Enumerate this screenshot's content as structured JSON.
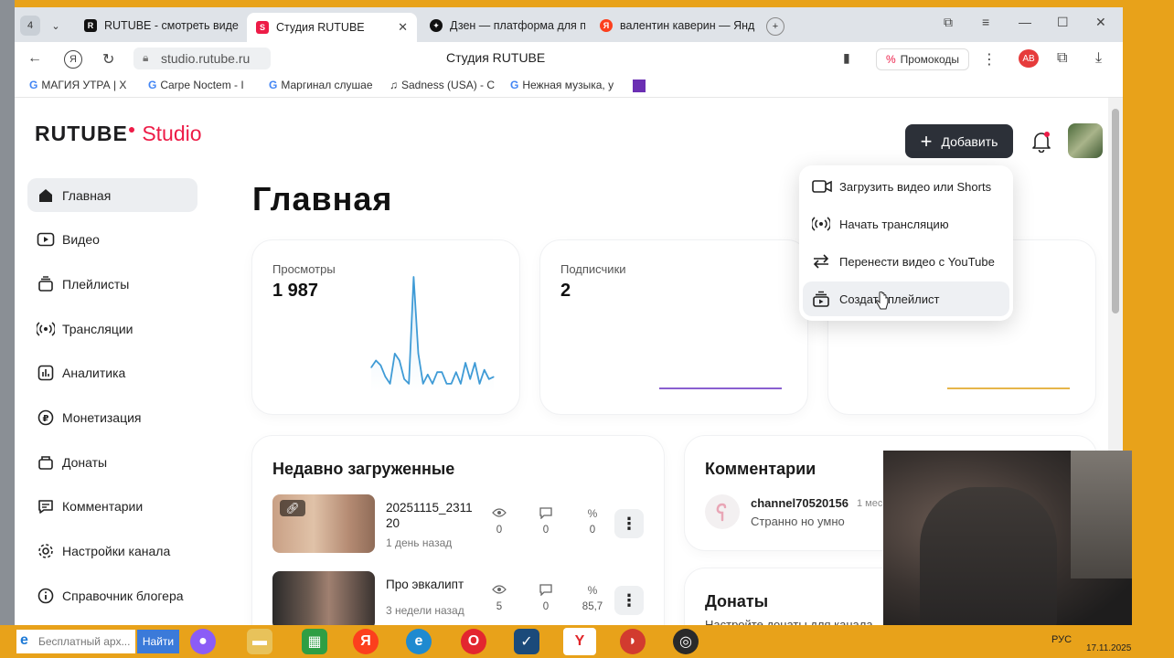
{
  "browser": {
    "tab_counter": "4",
    "tabs": [
      {
        "label": "RUTUBE - смотреть виде"
      },
      {
        "label": "Студия RUTUBE"
      },
      {
        "label": "Дзен — платформа для п"
      },
      {
        "label": "валентин каверин — Янд"
      }
    ],
    "url": "studio.rutube.ru",
    "page_title": "Студия RUTUBE",
    "promo_label": "Промокоды",
    "bookmarks": [
      {
        "label": "МАГИЯ УТРА | Х"
      },
      {
        "label": "Carpe Noctem - I"
      },
      {
        "label": "Маргинал слушае"
      },
      {
        "label": "Sadness (USA) - C"
      },
      {
        "label": "Нежная музыка, у"
      }
    ]
  },
  "header": {
    "logo_brand": "RUTUBE",
    "logo_studio": "Studio",
    "add_button": "Добавить"
  },
  "sidebar": {
    "items": [
      {
        "label": "Главная",
        "icon": "home-icon"
      },
      {
        "label": "Видео",
        "icon": "video-icon"
      },
      {
        "label": "Плейлисты",
        "icon": "playlist-icon"
      },
      {
        "label": "Трансляции",
        "icon": "broadcast-icon"
      },
      {
        "label": "Аналитика",
        "icon": "analytics-icon"
      },
      {
        "label": "Монетизация",
        "icon": "ruble-icon"
      },
      {
        "label": "Донаты",
        "icon": "gift-icon"
      },
      {
        "label": "Комментарии",
        "icon": "comment-icon"
      },
      {
        "label": "Настройки канала",
        "icon": "gear-icon"
      },
      {
        "label": "Справочник блогера",
        "icon": "info-icon"
      }
    ]
  },
  "main": {
    "title": "Главная",
    "stats": [
      {
        "label": "Просмотры",
        "value": "1 987"
      },
      {
        "label": "Подписчики",
        "value": "2"
      }
    ]
  },
  "chart_data": {
    "type": "line",
    "values": [
      18,
      24,
      20,
      10,
      4,
      30,
      24,
      8,
      4,
      96,
      30,
      4,
      12,
      4,
      14,
      14,
      4,
      4,
      14,
      4,
      22,
      8,
      22,
      4,
      16,
      8,
      10
    ]
  },
  "add_menu": {
    "items": [
      {
        "label": "Загрузить видео или Shorts",
        "icon": "upload-video-icon"
      },
      {
        "label": "Начать трансляцию",
        "icon": "broadcast-icon"
      },
      {
        "label": "Перенести видео с YouTube",
        "icon": "transfer-icon"
      },
      {
        "label": "Создать плейлист",
        "icon": "create-playlist-icon"
      }
    ]
  },
  "recent": {
    "title": "Недавно загруженные",
    "videos": [
      {
        "title": "20251115_231120",
        "date": "1 день назад",
        "views": "0",
        "comments": "0",
        "rating": "0"
      },
      {
        "title": "Про эвкалипт",
        "date": "3 недели назад",
        "views": "5",
        "comments": "0",
        "rating": "85,7"
      }
    ]
  },
  "comments": {
    "title": "Комментарии",
    "items": [
      {
        "author": "channel70520156",
        "time": "1 мес",
        "text": "Странно но умно"
      }
    ]
  },
  "donations": {
    "title": "Донаты",
    "text": "Настройте донаты для канала,"
  },
  "taskbar": {
    "search_placeholder": "Бесплатный арх...",
    "find_button": "Найти",
    "lang": "РУС",
    "date": "17.11.2025"
  },
  "colors": {
    "brand_red": "#ed1c47",
    "views_line": "#3f9bd6",
    "subscribers_line": "#8a5fd0",
    "third_line": "#e6b54a",
    "add_button_bg": "#2c3038"
  }
}
